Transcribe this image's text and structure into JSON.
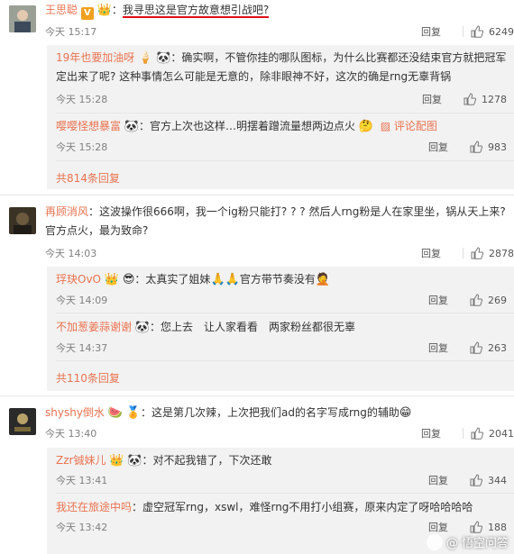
{
  "colors": {
    "username": "#eb7350",
    "text": "#333333",
    "meta": "#808080",
    "sub_bg": "#f2f2f2",
    "underline": "#e0101a"
  },
  "labels": {
    "reply": "回复",
    "view_pic": "评论配图"
  },
  "watermark": "@ 悟空问答",
  "comments": [
    {
      "user": "王思聪",
      "text": "我寻思这是官方故意想引战吧?",
      "time": "今天 15:17",
      "likes": "6249",
      "replies": [
        {
          "user": "19年也要加油呀",
          "text": "确实啊，不管你挂的哪队图标，为什么比赛都还没结束官方就把冠军定出来了呢? 这种事情怎么可能是无意的，除非眼神不好，这次的确是rng无辜背锅",
          "time": "今天 15:28",
          "likes": "1278"
        },
        {
          "user": "嘤嘤怪想暴富",
          "text": "官方上次也这样…明摆着蹭流量想两边点火",
          "time": "今天 15:28",
          "likes": "983"
        }
      ],
      "more": "共814条回复"
    },
    {
      "user": "再顾消风",
      "text": "这波操作很666啊，我一个ig粉只能打? ? ? 然后人rng粉是人在家里坐，锅从天上来? 官方点火，最为致命?",
      "time": "今天 14:03",
      "likes": "2878",
      "replies": [
        {
          "user": "琈玦OvO",
          "text": "太真实了姐妹",
          "text2": "官方带节奏没有",
          "time": "今天 14:09",
          "likes": "269"
        },
        {
          "user": "不加葱姜蒜谢谢",
          "text": "您上去　让人家看看　两家粉丝都很无辜",
          "time": "今天 14:37",
          "likes": "263"
        }
      ],
      "more": "共110条回复"
    },
    {
      "user": "shyshy倒水",
      "text": "这是第几次辣，上次把我们ad的名字写成rng的辅助",
      "time": "今天 13:40",
      "likes": "2041",
      "replies": [
        {
          "user": "Zzr铖妹儿",
          "text": "对不起我错了，下次还敢",
          "time": "今天 13:41",
          "likes": "344"
        },
        {
          "user": "我还在旅途中吗",
          "text": "虚空冠军rng，xswl，难怪rng不用打小组赛，原来内定了呀哈哈哈哈",
          "time": "今天 13:42",
          "likes": "188"
        }
      ]
    }
  ]
}
